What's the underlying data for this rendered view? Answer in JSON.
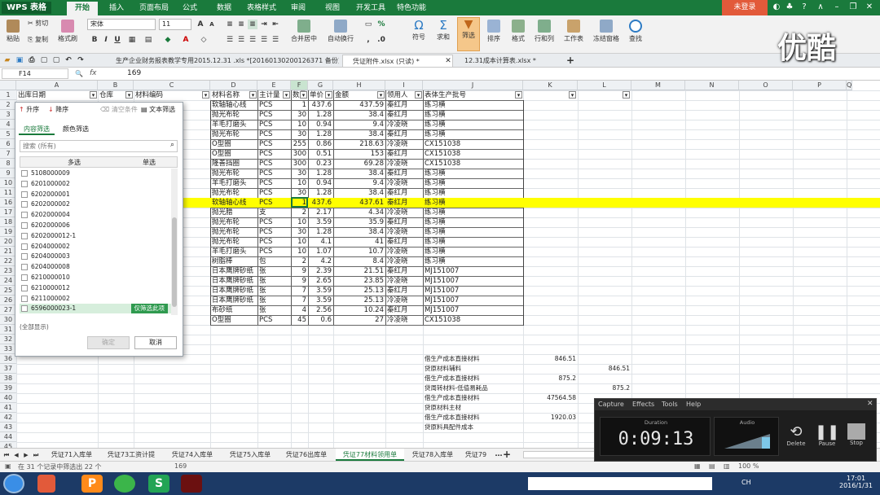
{
  "app": {
    "name": "WPS 表格",
    "login": "未登录",
    "watermark": "优酷"
  },
  "ribbon_tabs": [
    "开始",
    "插入",
    "页面布局",
    "公式",
    "数据",
    "表格样式",
    "审阅",
    "视图",
    "开发工具",
    "特色功能"
  ],
  "ribbon": {
    "paste": "粘贴",
    "cut": "剪切",
    "copy": "复制",
    "format_painter": "格式刷",
    "font": "宋体",
    "size": "11",
    "merge": "合并居中",
    "wrap": "自动换行",
    "symbol": "符号",
    "sum": "求和",
    "filter": "筛选",
    "sort": "排序",
    "format": "格式",
    "rowcol": "行和列",
    "sheet": "工作表",
    "freeze": "冻结窗格",
    "find": "查找"
  },
  "doc_tabs": [
    "生产企业财务报表教学专用2015.12.31 .xls *[20160130200126371 备份]",
    "凭证附件.xlsx (只读) *",
    "12.31成本计算表.xlsx *"
  ],
  "formula": {
    "cell": "F14",
    "fx": "fx",
    "value": "169"
  },
  "columns": [
    "A",
    "B",
    "C",
    "D",
    "E",
    "F",
    "G",
    "H",
    "I",
    "J",
    "K",
    "L",
    "M",
    "N",
    "O",
    "P",
    "Q"
  ],
  "headers": {
    "a": "出库日期",
    "b": "仓库",
    "c": "材料编码",
    "d": "材料名称",
    "e": "主计量",
    "f": "数量",
    "g": "单价",
    "h": "金额",
    "i": "领用人",
    "j": "表体生产批号"
  },
  "row_numbers": [
    "1",
    "2",
    "3",
    "4",
    "5",
    "6",
    "7",
    "8",
    "9",
    "10",
    "11",
    "16",
    "17",
    "18",
    "19",
    "20",
    "21",
    "22",
    "23",
    "24",
    "25",
    "26",
    "27",
    "30",
    "31",
    "32",
    "33",
    "36",
    "37",
    "38",
    "39",
    "40",
    "41",
    "42",
    "43",
    "44",
    "45",
    "46"
  ],
  "rows": [
    {
      "d": "软轴轴心线",
      "e": "PCS",
      "f": "1",
      "g": "437.6",
      "h": "437.59",
      "i": "秦红月",
      "j": "练习横"
    },
    {
      "d": "抛光布轮",
      "e": "PCS",
      "f": "30",
      "g": "1.28",
      "h": "38.4",
      "i": "秦红月",
      "j": "练习横"
    },
    {
      "d": "羊毛打磨头",
      "e": "PCS",
      "f": "10",
      "g": "0.94",
      "h": "9.4",
      "i": "冷凌晓",
      "j": "练习横"
    },
    {
      "d": "抛光布轮",
      "e": "PCS",
      "f": "30",
      "g": "1.28",
      "h": "38.4",
      "i": "秦红月",
      "j": "练习横"
    },
    {
      "d": "O型圈",
      "e": "PCS",
      "f": "255",
      "g": "0.86",
      "h": "218.63",
      "i": "冷凌晓",
      "j": "CX151038"
    },
    {
      "d": "O型圈",
      "e": "PCS",
      "f": "300",
      "g": "0.51",
      "h": "153",
      "i": "秦红月",
      "j": "CX151038"
    },
    {
      "d": "隆善挡圈",
      "e": "PCS",
      "f": "300",
      "g": "0.23",
      "h": "69.28",
      "i": "冷凌晓",
      "j": "CX151038"
    },
    {
      "d": "抛光布轮",
      "e": "PCS",
      "f": "30",
      "g": "1.28",
      "h": "38.4",
      "i": "秦红月",
      "j": "练习横"
    },
    {
      "d": "羊毛打磨头",
      "e": "PCS",
      "f": "10",
      "g": "0.94",
      "h": "9.4",
      "i": "冷凌晓",
      "j": "练习横"
    },
    {
      "d": "抛光布轮",
      "e": "PCS",
      "f": "30",
      "g": "1.28",
      "h": "38.4",
      "i": "秦红月",
      "j": "练习横"
    },
    {
      "d": "软轴轴心线",
      "e": "PCS",
      "f": "1",
      "g": "437.6",
      "h": "437.61",
      "i": "秦红月",
      "j": "练习横",
      "hl": true
    },
    {
      "d": "抛光腊",
      "e": "支",
      "f": "2",
      "g": "2.17",
      "h": "4.34",
      "i": "冷凌晓",
      "j": "练习横"
    },
    {
      "d": "抛光布轮",
      "e": "PCS",
      "f": "10",
      "g": "3.59",
      "h": "35.9",
      "i": "秦红月",
      "j": "练习横"
    },
    {
      "d": "抛光布轮",
      "e": "PCS",
      "f": "30",
      "g": "1.28",
      "h": "38.4",
      "i": "冷凌晓",
      "j": "练习横"
    },
    {
      "d": "抛光布轮",
      "e": "PCS",
      "f": "10",
      "g": "4.1",
      "h": "41",
      "i": "秦红月",
      "j": "练习横"
    },
    {
      "d": "羊毛打磨头",
      "e": "PCS",
      "f": "10",
      "g": "1.07",
      "h": "10.7",
      "i": "冷凌晓",
      "j": "练习横"
    },
    {
      "d": "树脂棒",
      "e": "包",
      "f": "2",
      "g": "4.2",
      "h": "8.4",
      "i": "冷凌晓",
      "j": "练习横"
    },
    {
      "d": "日本鹰牌砂纸",
      "e": "张",
      "f": "9",
      "g": "2.39",
      "h": "21.51",
      "i": "秦红月",
      "j": "MJ151007"
    },
    {
      "d": "日本鹰牌砂纸",
      "e": "张",
      "f": "9",
      "g": "2.65",
      "h": "23.85",
      "i": "冷凌晓",
      "j": "MJ151007"
    },
    {
      "d": "日本鹰牌砂纸",
      "e": "张",
      "f": "7",
      "g": "3.59",
      "h": "25.13",
      "i": "秦红月",
      "j": "MJ151007"
    },
    {
      "d": "日本鹰牌砂纸",
      "e": "张",
      "f": "7",
      "g": "3.59",
      "h": "25.13",
      "i": "冷凌晓",
      "j": "MJ151007"
    },
    {
      "d": "布砂纸",
      "e": "张",
      "f": "4",
      "g": "2.56",
      "h": "10.24",
      "i": "秦红月",
      "j": "MJ151007"
    },
    {
      "d": "O型圈",
      "e": "PCS",
      "f": "45",
      "g": "0.6",
      "h": "27",
      "i": "冷凌晓",
      "j": "CX151038"
    }
  ],
  "summary": [
    {
      "j": "借生产成本直接材料",
      "k": "846.51",
      "l": ""
    },
    {
      "j": "贷原材料辅料",
      "k": "",
      "l": "846.51"
    },
    {
      "j": "借生产成本直接材料",
      "k": "875.2",
      "l": ""
    },
    {
      "j": "贷周转材料-低值易耗品",
      "k": "",
      "l": "875.2"
    },
    {
      "j": "借生产成本直接材料",
      "k": "47564.58",
      "l": ""
    },
    {
      "j": "贷原材料主材",
      "k": "",
      "l": "47564.58"
    },
    {
      "j": "借生产成本直接材料",
      "k": "1920.03",
      "l": ""
    },
    {
      "j": "贷原料具配件成本",
      "k": "",
      "l": "1920.0"
    }
  ],
  "filter": {
    "asc": "升序",
    "desc": "降序",
    "clear": "清空条件",
    "text_filter": "文本筛选",
    "tab_content": "内容筛选",
    "tab_color": "颜色筛选",
    "search_placeholder": "搜索 (所有)",
    "multi": "多选",
    "single": "单选",
    "items": [
      "5108000009",
      "6201000002",
      "6202000001",
      "6202000002",
      "6202000004",
      "6202000006",
      "6202000012-1",
      "6204000002",
      "6204000003",
      "6204000008",
      "6210000010",
      "6210000012",
      "6211000002",
      "6596000023-1"
    ],
    "only_this": "仅筛选此项",
    "show_all": "(全部显示)",
    "ok": "确定",
    "cancel": "取消"
  },
  "sheet_tabs": [
    "凭证71入库单",
    "凭证73工资计提",
    "凭证74入库单",
    "凭证75入库单",
    "凭证76出库单",
    "凭证77材料领用单",
    "凭证78入库单",
    "凭证79"
  ],
  "status": {
    "text": "在 31 个记录中筛选出 22 个",
    "value": "169",
    "zoom": "100 %"
  },
  "recorder": {
    "menu": [
      "Capture",
      "Effects",
      "Tools",
      "Help"
    ],
    "duration_label": "Duration",
    "time": "0:09:13",
    "audio_label": "Audio",
    "delete": "Delete",
    "pause": "Pause",
    "stop": "Stop"
  },
  "tray": {
    "time": "17:01",
    "date": "2016/1/31",
    "lang": "CH"
  },
  "colors": {
    "green": "#1a7a3c",
    "highlight": "#ffff00",
    "filter_btn": "#f5b04b"
  }
}
